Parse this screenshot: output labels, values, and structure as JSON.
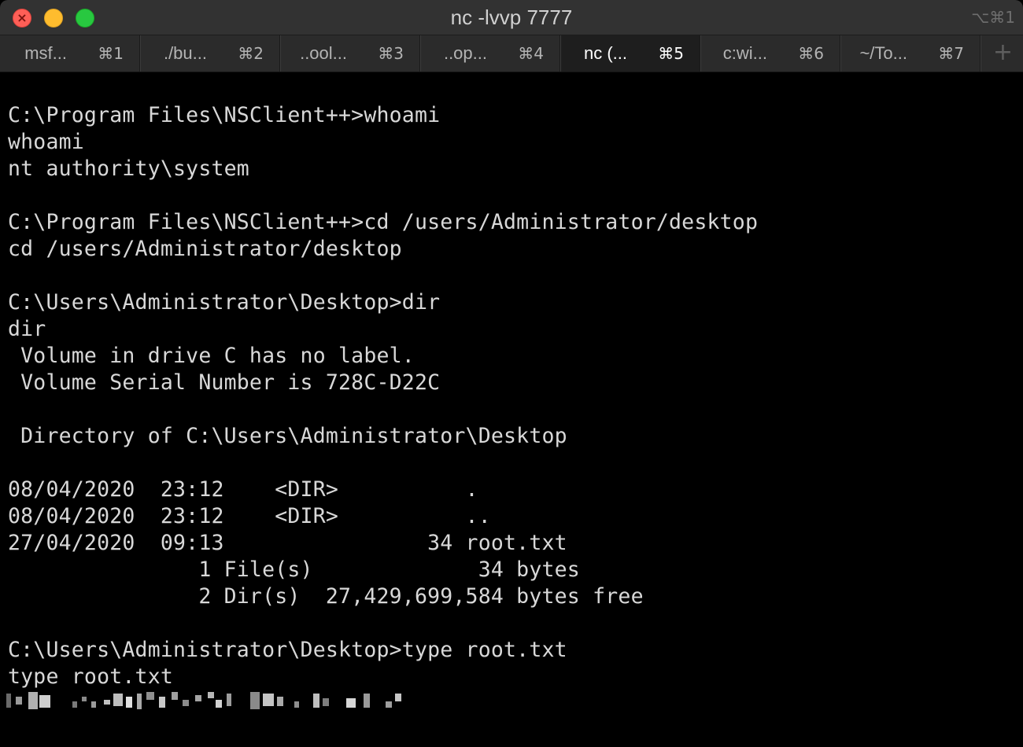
{
  "window": {
    "title": "nc -lvvp 7777",
    "shortcut": "⌥⌘1"
  },
  "traffic_lights": {
    "close_glyph": "×"
  },
  "tabs": [
    {
      "label": "msf...",
      "shortcut": "⌘1",
      "active": false
    },
    {
      "label": "./bu...",
      "shortcut": "⌘2",
      "active": false
    },
    {
      "label": "..ool...",
      "shortcut": "⌘3",
      "active": false
    },
    {
      "label": "..op...",
      "shortcut": "⌘4",
      "active": false
    },
    {
      "label": "nc (...",
      "shortcut": "⌘5",
      "active": true
    },
    {
      "label": "c:wi...",
      "shortcut": "⌘6",
      "active": false
    },
    {
      "label": "~/To...",
      "shortcut": "⌘7",
      "active": false
    }
  ],
  "new_tab_icon": "+",
  "terminal": {
    "lines": [
      "C:\\Program Files\\NSClient++>whoami",
      "whoami",
      "nt authority\\system",
      "",
      "C:\\Program Files\\NSClient++>cd /users/Administrator/desktop",
      "cd /users/Administrator/desktop",
      "",
      "C:\\Users\\Administrator\\Desktop>dir",
      "dir",
      " Volume in drive C has no label.",
      " Volume Serial Number is 728C-D22C",
      "",
      " Directory of C:\\Users\\Administrator\\Desktop",
      "",
      "08/04/2020  23:12    <DIR>          .",
      "08/04/2020  23:12    <DIR>          ..",
      "27/04/2020  09:13                34 root.txt",
      "               1 File(s)             34 bytes",
      "               2 Dir(s)  27,429,699,584 bytes free",
      "",
      "C:\\Users\\Administrator\\Desktop>type root.txt",
      "type root.txt"
    ],
    "colors": {
      "background": "#000000",
      "foreground": "#d8d8d8"
    }
  }
}
